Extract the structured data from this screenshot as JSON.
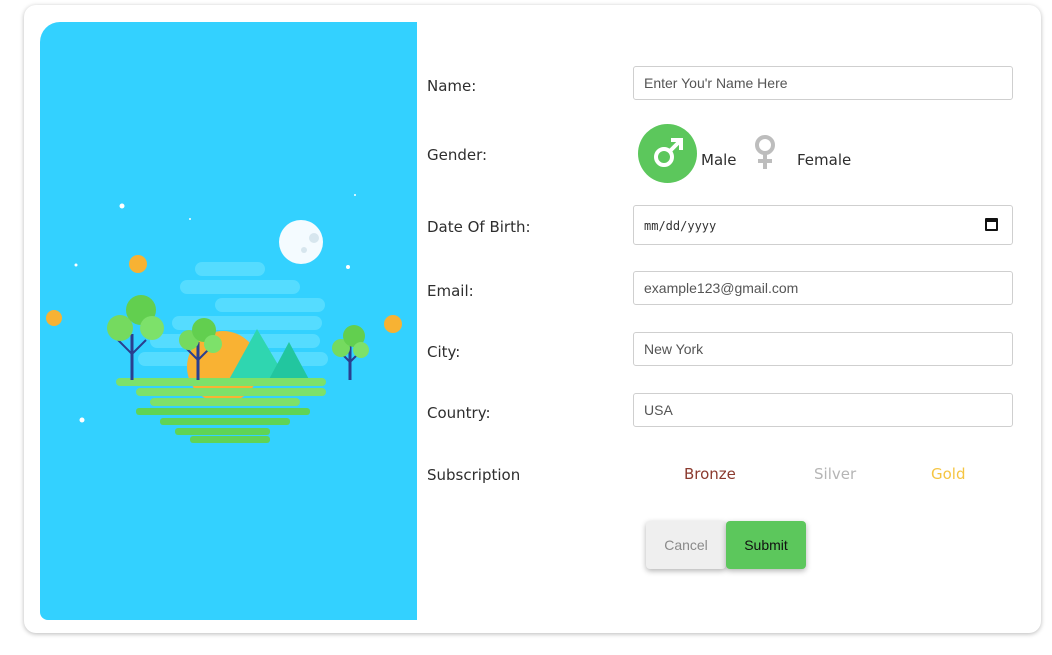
{
  "form": {
    "name_label": "Name:",
    "name_placeholder": "Enter You'r Name Here",
    "gender_label": "Gender:",
    "gender_options": {
      "male": "Male",
      "female": "Female",
      "selected": "Male"
    },
    "dob_label": "Date Of Birth:",
    "dob_placeholder": "mm/dd/yyyy",
    "email_label": "Email:",
    "email_placeholder": "example123@gmail.com",
    "city_label": "City:",
    "city_placeholder": "New York",
    "country_label": "Country:",
    "country_placeholder": "USA",
    "subscription_label": "Subscription",
    "subscription_options": [
      {
        "label": "Bronze",
        "color": "#8b3a2e"
      },
      {
        "label": "Silver",
        "color": "#b5b5b5"
      },
      {
        "label": "Gold",
        "color": "#f5c542"
      }
    ],
    "cancel_label": "Cancel",
    "submit_label": "Submit"
  },
  "colors": {
    "panel_bg": "#33d1ff",
    "accent_green": "#5cc75c"
  },
  "icons": {
    "gender_male": "male-symbol-icon",
    "gender_female": "female-symbol-icon",
    "date_picker": "calendar-icon"
  }
}
